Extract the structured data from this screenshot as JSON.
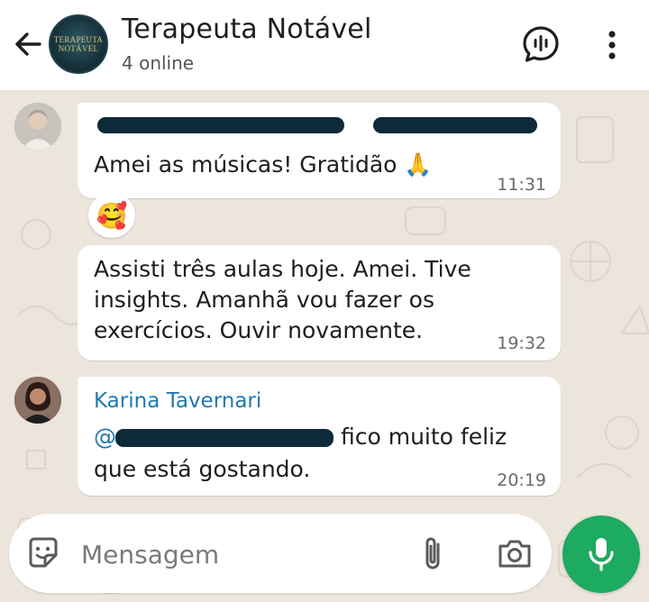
{
  "header": {
    "title": "Terapeuta Notável",
    "subtitle": "4 online",
    "avatar_text_line1": "TERAPEUTA",
    "avatar_text_line2": "NOTÁVEL"
  },
  "messages": [
    {
      "sender": "",
      "sender_redacted": true,
      "text": "Amei as músicas! Gratidão 🙏",
      "time": "11:31"
    },
    {
      "text_lines": [
        "Assisti três aulas hoje. Amei. Tive",
        "insights. Amanhã vou fazer os",
        "exercícios. Ouvir novamente."
      ],
      "time": "19:32"
    },
    {
      "sender": "Karina Tavernari",
      "mention_prefix": "@",
      "text_lines": [
        "fico muito feliz",
        "que está gostando."
      ],
      "time": "20:19"
    }
  ],
  "reaction": "🥰",
  "input": {
    "placeholder": "Mensagem",
    "value": ""
  },
  "icons": {
    "back": "arrow-left-icon",
    "voice_chat": "voice-chat-icon",
    "more": "more-vertical-icon",
    "sticker": "sticker-icon",
    "attach": "paperclip-icon",
    "camera": "camera-icon",
    "mic": "microphone-icon"
  },
  "colors": {
    "accent_green": "#1daa61",
    "sender_blue": "#1f78b4",
    "chat_background": "#ece5dc",
    "bubble": "#ffffff"
  }
}
